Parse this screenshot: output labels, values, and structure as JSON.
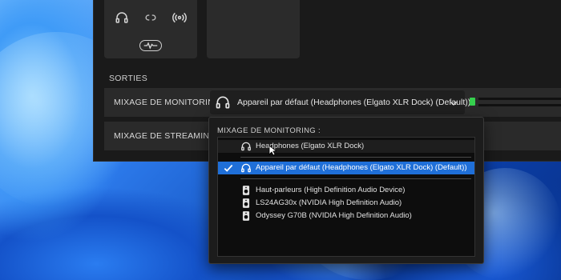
{
  "section": {
    "label": "SORTIES"
  },
  "rows": [
    {
      "label": "MIXAGE DE MONITORING",
      "device": "Appareil par défaut (Headphones (Elgato XLR Dock) (Default))"
    },
    {
      "label": "MIXAGE DE STREAMING"
    }
  ],
  "popup": {
    "title": "MIXAGE DE MONITORING :",
    "options": [
      {
        "label": "Headphones (Elgato XLR Dock)",
        "icon": "headphones-icon",
        "state": "hover"
      },
      {
        "label": "Appareil par défaut (Headphones (Elgato XLR Dock) (Default))",
        "icon": "headphones-icon",
        "state": "selected"
      },
      {
        "label": "Haut-parleurs (High Definition Audio Device)",
        "icon": "speaker-icon"
      },
      {
        "label": "LS24AG30x (NVIDIA High Definition Audio)",
        "icon": "speaker-icon"
      },
      {
        "label": "Odyssey G70B (NVIDIA High Definition Audio)",
        "icon": "speaker-icon"
      }
    ]
  },
  "colors": {
    "accent": "#1f6fd8",
    "meter": "#36d04e",
    "panel": "#1a1a1a"
  },
  "tile_icons": [
    "headphones-icon",
    "link-icon",
    "broadcast-icon",
    "waveform-icon"
  ]
}
